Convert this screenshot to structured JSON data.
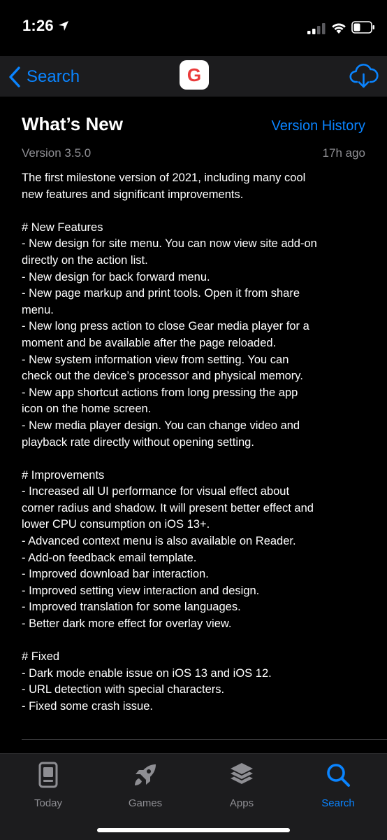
{
  "status_bar": {
    "time": "1:26"
  },
  "nav": {
    "back_label": "Search",
    "app_icon_letter": "G",
    "icons": {
      "back": "chevron-left-icon",
      "download": "cloud-download-icon",
      "location": "location-arrow-icon"
    }
  },
  "whats_new": {
    "title": "What’s New",
    "version_history_label": "Version History",
    "version": "Version 3.5.0",
    "time_ago": "17h ago",
    "notes": [
      "The first milestone version of 2021, including many cool",
      "new features and significant improvements.",
      "",
      "# New Features",
      "- New design for site menu. You can now view site add-on",
      "directly on the action list.",
      "- New design for back forward menu.",
      "- New page markup and print tools. Open it from share",
      "menu.",
      "- New long press action to close Gear media player for a",
      "moment and be available after the page reloaded.",
      "- New system information view from setting. You can",
      "check out the device’s processor and physical memory.",
      "- New app shortcut actions from long pressing the app",
      "icon on the home screen.",
      "- New media player design. You can change video and",
      "playback rate directly without opening setting.",
      "",
      "# Improvements",
      "- Increased all UI performance for visual effect about",
      "corner radius and shadow. It will present better effect and",
      "lower CPU consumption on iOS 13+.",
      "- Advanced context menu is also available on Reader.",
      "- Add-on feedback email template.",
      "- Improved download bar interaction.",
      "- Improved setting view interaction and design.",
      "- Improved translation for some languages.",
      "- Better dark more effect for overlay view.",
      "",
      "# Fixed",
      "- Dark mode enable issue on iOS 13 and iOS 12.",
      "- URL detection with special characters.",
      "- Fixed some crash issue."
    ]
  },
  "tab_bar": {
    "tabs": [
      {
        "label": "Today",
        "icon": "today-icon",
        "active": false
      },
      {
        "label": "Games",
        "icon": "rocket-icon",
        "active": false
      },
      {
        "label": "Apps",
        "icon": "apps-stack-icon",
        "active": false
      },
      {
        "label": "Search",
        "icon": "search-icon",
        "active": true
      }
    ]
  },
  "colors": {
    "accent": "#0a84ff",
    "secondary_text": "#8e8e93",
    "bar_background": "#1c1c1e",
    "app_icon_letter": "#ea3a3a"
  }
}
